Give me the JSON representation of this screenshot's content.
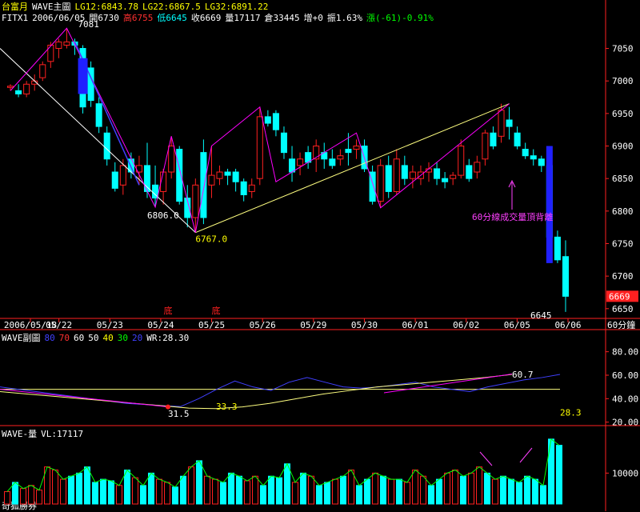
{
  "header": {
    "line1": {
      "symbol": "台富月",
      "study": "WAVE主圖",
      "lg12": "LG12:6843.78",
      "lg22": "LG22:6867.5",
      "lg32": "LG32:6891.22"
    },
    "line2": {
      "code": "FITX1",
      "date": "2006/06/05",
      "open": "開6730",
      "high": "高6755",
      "low": "低6645",
      "close": "收6669",
      "volume": "量17117",
      "oi": "倉33445",
      "oi_change": "增+0",
      "amplitude": "振1.63%",
      "change": "漲(-61)-0.91%"
    }
  },
  "sub_header": {
    "label": "WAVE副圖",
    "levels": [
      "80",
      "70",
      "60",
      "50",
      "40",
      "30",
      "20"
    ],
    "wr": "WR:28.30"
  },
  "volume_header": {
    "label": "WAVE-量",
    "vl": "VL:17117"
  },
  "footer": {
    "broker": "奇狐勝券",
    "interval": "60分鐘"
  },
  "colors": {
    "up": "#ff2020",
    "down": "#00ffff",
    "wave": "#ff00ff",
    "trend": "#ffff80",
    "downline": "#4040ff",
    "text": "#ffffff"
  },
  "chart_data": {
    "type": "candlestick",
    "y_ticks": [
      6650,
      6700,
      6750,
      6800,
      6850,
      6900,
      6950,
      7000,
      7050
    ],
    "ylim": [
      6635,
      7090
    ],
    "x_tick_labels": [
      "2006/05/18",
      "05/22",
      "05/23",
      "05/24",
      "05/25",
      "05/26",
      "05/29",
      "05/30",
      "06/01",
      "06/02",
      "06/05",
      "06/06"
    ],
    "bottom_markers": [
      "底",
      "底"
    ],
    "last_price": "6669",
    "annotations": {
      "peak": "7081",
      "low1": "6806.0",
      "low2": "6767.0",
      "low3": "6645",
      "note": "60分線成交量頂背離"
    },
    "candles": [
      [
        6990,
        6995,
        6985,
        6992
      ],
      [
        6985,
        6995,
        6975,
        6980
      ],
      [
        6980,
        7000,
        6975,
        6995
      ],
      [
        6995,
        7010,
        6985,
        7000
      ],
      [
        7005,
        7030,
        7000,
        7025
      ],
      [
        7030,
        7060,
        7020,
        7055
      ],
      [
        7050,
        7065,
        7035,
        7060
      ],
      [
        7055,
        7081,
        7050,
        7060
      ],
      [
        7060,
        7065,
        7040,
        7055
      ],
      [
        7050,
        7055,
        6950,
        6960
      ],
      [
        7020,
        7030,
        6960,
        6970
      ],
      [
        6965,
        6975,
        6920,
        6930
      ],
      [
        6920,
        6930,
        6870,
        6880
      ],
      [
        6860,
        6875,
        6830,
        6835
      ],
      [
        6840,
        6880,
        6825,
        6870
      ],
      [
        6880,
        6890,
        6850,
        6860
      ],
      [
        6860,
        6885,
        6840,
        6870
      ],
      [
        6870,
        6905,
        6820,
        6830
      ],
      [
        6840,
        6870,
        6806,
        6820
      ],
      [
        6830,
        6865,
        6810,
        6860
      ],
      [
        6860,
        6915,
        6850,
        6900
      ],
      [
        6895,
        6900,
        6810,
        6815
      ],
      [
        6820,
        6840,
        6775,
        6790
      ],
      [
        6790,
        6850,
        6767,
        6840
      ],
      [
        6890,
        6910,
        6780,
        6790
      ],
      [
        6840,
        6900,
        6820,
        6855
      ],
      [
        6850,
        6870,
        6840,
        6860
      ],
      [
        6860,
        6865,
        6840,
        6855
      ],
      [
        6860,
        6865,
        6830,
        6845
      ],
      [
        6845,
        6850,
        6815,
        6825
      ],
      [
        6830,
        6850,
        6820,
        6840
      ],
      [
        6850,
        6960,
        6840,
        6945
      ],
      [
        6945,
        6955,
        6930,
        6935
      ],
      [
        6950,
        6955,
        6915,
        6925
      ],
      [
        6920,
        6930,
        6880,
        6890
      ],
      [
        6880,
        6900,
        6845,
        6860
      ],
      [
        6870,
        6890,
        6855,
        6880
      ],
      [
        6890,
        6900,
        6865,
        6875
      ],
      [
        6880,
        6910,
        6860,
        6900
      ],
      [
        6890,
        6905,
        6865,
        6880
      ],
      [
        6880,
        6895,
        6865,
        6870
      ],
      [
        6880,
        6895,
        6870,
        6885
      ],
      [
        6895,
        6920,
        6870,
        6890
      ],
      [
        6895,
        6910,
        6880,
        6900
      ],
      [
        6900,
        6910,
        6860,
        6865
      ],
      [
        6860,
        6870,
        6810,
        6815
      ],
      [
        6815,
        6880,
        6805,
        6870
      ],
      [
        6870,
        6885,
        6820,
        6830
      ],
      [
        6830,
        6895,
        6825,
        6880
      ],
      [
        6870,
        6885,
        6840,
        6850
      ],
      [
        6850,
        6870,
        6835,
        6860
      ],
      [
        6850,
        6870,
        6840,
        6860
      ],
      [
        6860,
        6875,
        6845,
        6865
      ],
      [
        6865,
        6875,
        6840,
        6850
      ],
      [
        6850,
        6860,
        6835,
        6845
      ],
      [
        6850,
        6860,
        6840,
        6855
      ],
      [
        6855,
        6910,
        6850,
        6900
      ],
      [
        6870,
        6880,
        6845,
        6850
      ],
      [
        6860,
        6885,
        6850,
        6875
      ],
      [
        6880,
        6925,
        6870,
        6920
      ],
      [
        6920,
        6930,
        6895,
        6900
      ],
      [
        6915,
        6965,
        6905,
        6955
      ],
      [
        6940,
        6960,
        6910,
        6930
      ],
      [
        6920,
        6930,
        6895,
        6900
      ],
      [
        6895,
        6905,
        6880,
        6885
      ],
      [
        6885,
        6895,
        6870,
        6880
      ],
      [
        6880,
        6885,
        6860,
        6870
      ],
      [
        6870,
        6890,
        6750,
        6760
      ],
      [
        6760,
        6770,
        6720,
        6725
      ],
      [
        6730,
        6755,
        6645,
        6669
      ]
    ],
    "oscillator": {
      "ylim": [
        15,
        90
      ],
      "y_ticks": [
        80,
        60,
        40,
        20
      ],
      "wave_values": [
        50,
        48,
        46,
        44,
        42,
        40,
        38,
        36,
        35,
        34,
        33.3,
        40,
        48,
        55,
        50,
        47,
        54,
        58,
        54,
        50,
        49,
        50,
        52,
        54,
        50,
        48,
        46,
        50,
        53,
        56,
        58,
        60.7
      ],
      "trend_values": [
        46,
        44,
        42,
        40,
        38,
        36,
        34,
        32,
        31.5,
        33,
        36,
        40,
        44,
        47,
        50,
        52,
        54,
        56,
        58,
        60.7
      ],
      "labels": [
        "31.5",
        "33.3",
        "60.7",
        "28.3"
      ],
      "hline": 48
    },
    "volume": {
      "y_ticks": [
        10000
      ],
      "ymax": 22000,
      "values": [
        4000,
        7000,
        5000,
        6000,
        4500,
        12000,
        11000,
        8000,
        9000,
        10000,
        12000,
        7000,
        8000,
        7500,
        6000,
        11000,
        8500,
        6000,
        10000,
        8000,
        7000,
        5500,
        9000,
        12000,
        14000,
        9000,
        8000,
        7000,
        10000,
        9000,
        7500,
        9000,
        6000,
        9000,
        8500,
        13000,
        7000,
        10000,
        9000,
        6000,
        7000,
        8000,
        9000,
        11000,
        6000,
        8000,
        10000,
        9000,
        8000,
        8000,
        7000,
        11000,
        9000,
        6000,
        8000,
        10000,
        11000,
        9000,
        10000,
        12000,
        10000,
        8000,
        9000,
        8000,
        7000,
        9000,
        8000,
        6000,
        21000,
        19000
      ]
    }
  }
}
